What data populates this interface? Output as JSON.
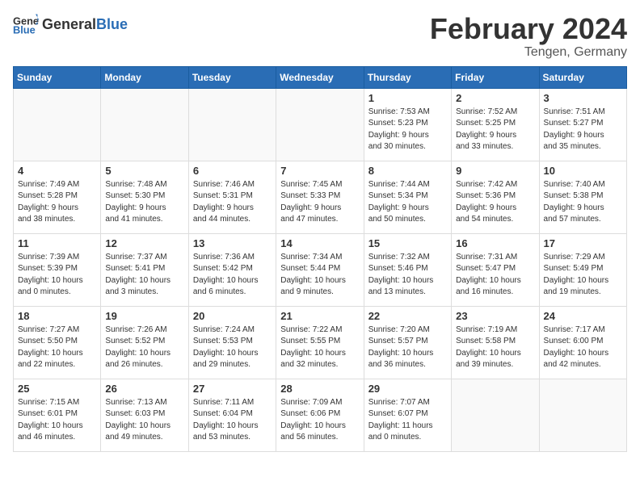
{
  "header": {
    "logo_general": "General",
    "logo_blue": "Blue",
    "month_title": "February 2024",
    "location": "Tengen, Germany"
  },
  "days_of_week": [
    "Sunday",
    "Monday",
    "Tuesday",
    "Wednesday",
    "Thursday",
    "Friday",
    "Saturday"
  ],
  "weeks": [
    [
      {
        "day": "",
        "info": ""
      },
      {
        "day": "",
        "info": ""
      },
      {
        "day": "",
        "info": ""
      },
      {
        "day": "",
        "info": ""
      },
      {
        "day": "1",
        "info": "Sunrise: 7:53 AM\nSunset: 5:23 PM\nDaylight: 9 hours\nand 30 minutes."
      },
      {
        "day": "2",
        "info": "Sunrise: 7:52 AM\nSunset: 5:25 PM\nDaylight: 9 hours\nand 33 minutes."
      },
      {
        "day": "3",
        "info": "Sunrise: 7:51 AM\nSunset: 5:27 PM\nDaylight: 9 hours\nand 35 minutes."
      }
    ],
    [
      {
        "day": "4",
        "info": "Sunrise: 7:49 AM\nSunset: 5:28 PM\nDaylight: 9 hours\nand 38 minutes."
      },
      {
        "day": "5",
        "info": "Sunrise: 7:48 AM\nSunset: 5:30 PM\nDaylight: 9 hours\nand 41 minutes."
      },
      {
        "day": "6",
        "info": "Sunrise: 7:46 AM\nSunset: 5:31 PM\nDaylight: 9 hours\nand 44 minutes."
      },
      {
        "day": "7",
        "info": "Sunrise: 7:45 AM\nSunset: 5:33 PM\nDaylight: 9 hours\nand 47 minutes."
      },
      {
        "day": "8",
        "info": "Sunrise: 7:44 AM\nSunset: 5:34 PM\nDaylight: 9 hours\nand 50 minutes."
      },
      {
        "day": "9",
        "info": "Sunrise: 7:42 AM\nSunset: 5:36 PM\nDaylight: 9 hours\nand 54 minutes."
      },
      {
        "day": "10",
        "info": "Sunrise: 7:40 AM\nSunset: 5:38 PM\nDaylight: 9 hours\nand 57 minutes."
      }
    ],
    [
      {
        "day": "11",
        "info": "Sunrise: 7:39 AM\nSunset: 5:39 PM\nDaylight: 10 hours\nand 0 minutes."
      },
      {
        "day": "12",
        "info": "Sunrise: 7:37 AM\nSunset: 5:41 PM\nDaylight: 10 hours\nand 3 minutes."
      },
      {
        "day": "13",
        "info": "Sunrise: 7:36 AM\nSunset: 5:42 PM\nDaylight: 10 hours\nand 6 minutes."
      },
      {
        "day": "14",
        "info": "Sunrise: 7:34 AM\nSunset: 5:44 PM\nDaylight: 10 hours\nand 9 minutes."
      },
      {
        "day": "15",
        "info": "Sunrise: 7:32 AM\nSunset: 5:46 PM\nDaylight: 10 hours\nand 13 minutes."
      },
      {
        "day": "16",
        "info": "Sunrise: 7:31 AM\nSunset: 5:47 PM\nDaylight: 10 hours\nand 16 minutes."
      },
      {
        "day": "17",
        "info": "Sunrise: 7:29 AM\nSunset: 5:49 PM\nDaylight: 10 hours\nand 19 minutes."
      }
    ],
    [
      {
        "day": "18",
        "info": "Sunrise: 7:27 AM\nSunset: 5:50 PM\nDaylight: 10 hours\nand 22 minutes."
      },
      {
        "day": "19",
        "info": "Sunrise: 7:26 AM\nSunset: 5:52 PM\nDaylight: 10 hours\nand 26 minutes."
      },
      {
        "day": "20",
        "info": "Sunrise: 7:24 AM\nSunset: 5:53 PM\nDaylight: 10 hours\nand 29 minutes."
      },
      {
        "day": "21",
        "info": "Sunrise: 7:22 AM\nSunset: 5:55 PM\nDaylight: 10 hours\nand 32 minutes."
      },
      {
        "day": "22",
        "info": "Sunrise: 7:20 AM\nSunset: 5:57 PM\nDaylight: 10 hours\nand 36 minutes."
      },
      {
        "day": "23",
        "info": "Sunrise: 7:19 AM\nSunset: 5:58 PM\nDaylight: 10 hours\nand 39 minutes."
      },
      {
        "day": "24",
        "info": "Sunrise: 7:17 AM\nSunset: 6:00 PM\nDaylight: 10 hours\nand 42 minutes."
      }
    ],
    [
      {
        "day": "25",
        "info": "Sunrise: 7:15 AM\nSunset: 6:01 PM\nDaylight: 10 hours\nand 46 minutes."
      },
      {
        "day": "26",
        "info": "Sunrise: 7:13 AM\nSunset: 6:03 PM\nDaylight: 10 hours\nand 49 minutes."
      },
      {
        "day": "27",
        "info": "Sunrise: 7:11 AM\nSunset: 6:04 PM\nDaylight: 10 hours\nand 53 minutes."
      },
      {
        "day": "28",
        "info": "Sunrise: 7:09 AM\nSunset: 6:06 PM\nDaylight: 10 hours\nand 56 minutes."
      },
      {
        "day": "29",
        "info": "Sunrise: 7:07 AM\nSunset: 6:07 PM\nDaylight: 11 hours\nand 0 minutes."
      },
      {
        "day": "",
        "info": ""
      },
      {
        "day": "",
        "info": ""
      }
    ]
  ]
}
